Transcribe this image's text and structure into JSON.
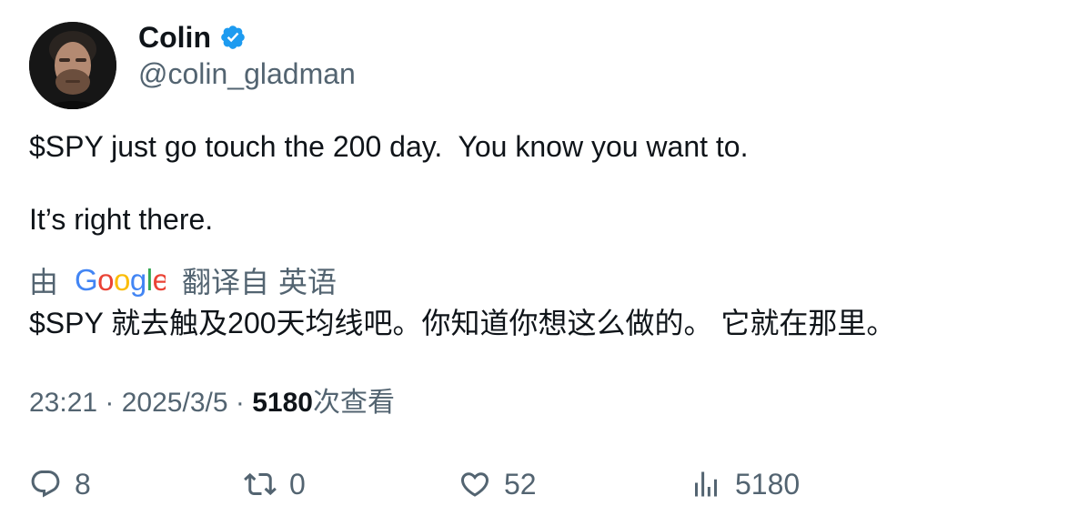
{
  "author": {
    "name": "Colin",
    "handle": "@colin_gladman",
    "verified": true
  },
  "tweet": {
    "line1": "$SPY just go touch the 200 day.  You know you want to.",
    "line2": "It’s right there."
  },
  "translation": {
    "by_label": "由",
    "provider": "Google",
    "translated_from_label": "翻译自",
    "source_language": "英语",
    "text": "$SPY 就去触及200天均线吧。你知道你想这么做的。 它就在那里。"
  },
  "meta": {
    "time": "23:21",
    "separator": " · ",
    "date": "2025/3/5",
    "views_count": "5180",
    "views_label": "次查看"
  },
  "actions": {
    "replies": "8",
    "retweets": "0",
    "likes": "52",
    "views": "5180"
  },
  "colors": {
    "verified_blue": "#1d9bf0",
    "text_primary": "#0f1419",
    "text_secondary": "#536471",
    "google_blue": "#4285F4",
    "google_red": "#EA4335",
    "google_yellow": "#FBBC05",
    "google_green": "#34A853"
  }
}
